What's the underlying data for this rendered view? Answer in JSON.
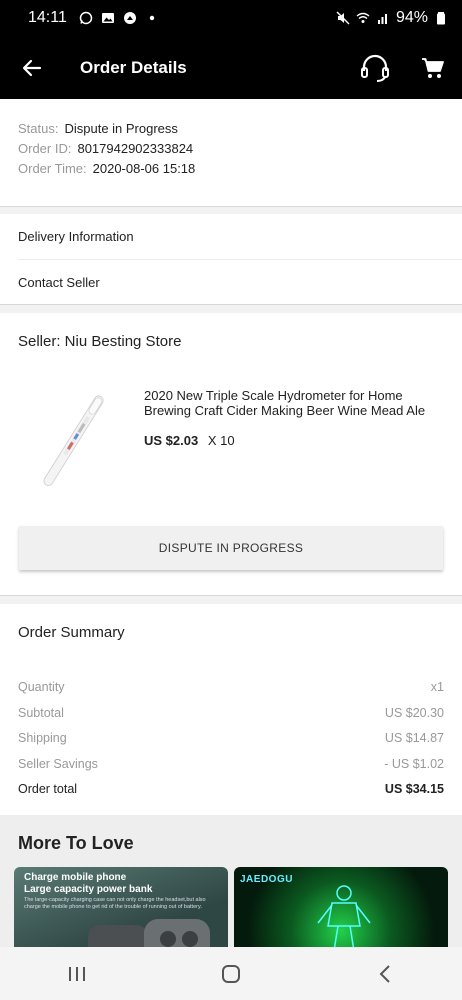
{
  "status_bar": {
    "time": "14:11",
    "battery": "94%"
  },
  "app_bar": {
    "title": "Order Details"
  },
  "order_status": {
    "status_label": "Status:",
    "status_value": "Dispute in Progress",
    "id_label": "Order ID:",
    "id_value": "8017942902333824",
    "time_label": "Order Time:",
    "time_value": "2020-08-06 15:18"
  },
  "links": {
    "delivery": "Delivery Information",
    "contact": "Contact Seller"
  },
  "seller": {
    "name": "Seller: Niu Besting Store",
    "product_title": "2020 New Triple Scale Hydrometer for Home Brewing Craft Cider Making Beer Wine Mead Ale",
    "price": "US $2.03",
    "quantity": "X 10",
    "dispute_button": "DISPUTE IN PROGRESS"
  },
  "summary": {
    "title": "Order Summary",
    "rows": [
      {
        "label": "Quantity",
        "value": "x1"
      },
      {
        "label": "Subtotal",
        "value": "US $20.30"
      },
      {
        "label": "Shipping",
        "value": "US $14.87"
      },
      {
        "label": "Seller Savings",
        "value": "- US $1.02"
      },
      {
        "label": "Order total",
        "value": "US $34.15"
      }
    ]
  },
  "more_to_love": {
    "title": "More To Love",
    "item1_line1": "Charge mobile phone",
    "item1_line2": "Large capacity power bank",
    "item1_desc": "The large-capacity charging case can not only charge the headset,but also charge the mobile phone to get rid of the trouble of running out of battery.",
    "item2_logo": "JAEDOGU"
  },
  "colors": {
    "header_bg": "#000000",
    "page_bg": "#f2f2f2",
    "muted_text": "#999999"
  },
  "icons": {
    "back": "arrow-left-icon",
    "support": "headset-icon",
    "cart": "cart-icon",
    "nav_recent": "recent-apps-icon",
    "nav_home": "home-icon",
    "nav_back": "chevron-left-icon"
  }
}
